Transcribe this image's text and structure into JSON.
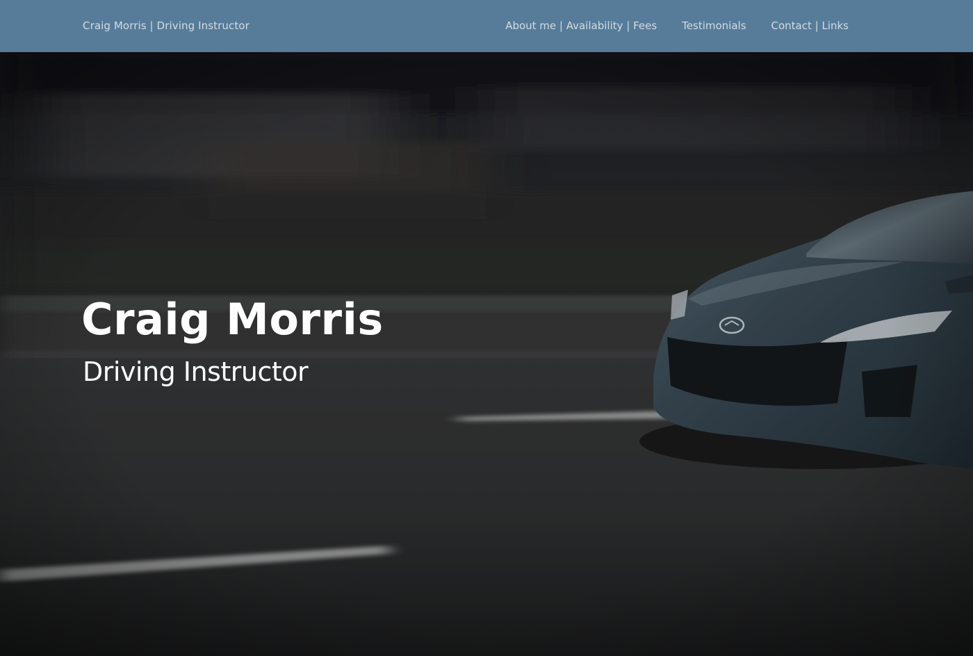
{
  "navbar": {
    "brand": "Craig Morris | Driving Instructor",
    "links": [
      {
        "label": "About me | Availability | Fees"
      },
      {
        "label": "Testimonials"
      },
      {
        "label": "Contact | Links"
      }
    ],
    "background_color": "#577c9a",
    "text_color": "#d2dbe3"
  },
  "hero": {
    "title": "Craig Morris",
    "subtitle": "Driving Instructor",
    "background_image": "motion-blurred-car-on-road",
    "text_color": "#ffffff"
  }
}
